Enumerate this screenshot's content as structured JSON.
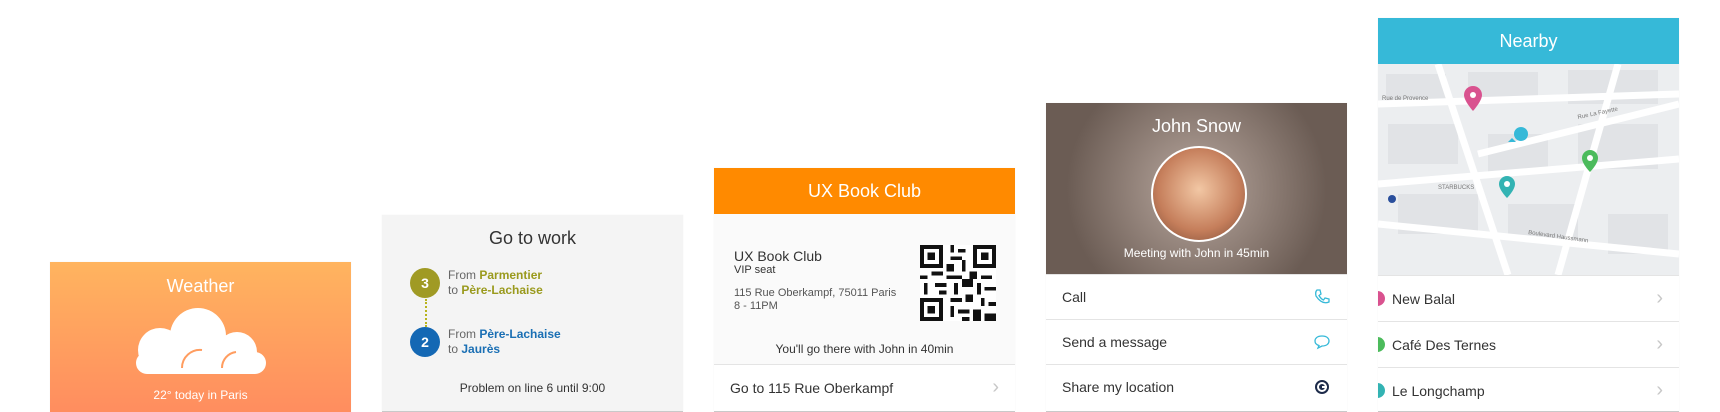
{
  "weather": {
    "title": "Weather",
    "summary": "22° today in Paris",
    "icon": "cloud-icon",
    "gradient": [
      "#ffb45f",
      "#ff8d5f"
    ]
  },
  "transit": {
    "title": "Go to work",
    "segments": [
      {
        "line": "3",
        "from_word": "From",
        "from": "Parmentier",
        "to_word": "to",
        "to": "Père-Lachaise",
        "color": "#a09a24"
      },
      {
        "line": "2",
        "from_word": "From",
        "from": "Père-Lachaise",
        "to_word": "to",
        "to": "Jaurès",
        "color": "#1468b4"
      }
    ],
    "problem": "Problem on line 6 until 9:00"
  },
  "ticket": {
    "header": "UX Book Club",
    "event_name": "UX Book Club",
    "seat": "VIP seat",
    "address": "115 Rue Oberkampf, 75011 Paris",
    "time": "8 - 11PM",
    "note": "You'll go there with John in 40min",
    "action": "Go to 115 Rue Oberkampf",
    "accent": "#ff8a00"
  },
  "contact": {
    "name": "John Snow",
    "subtitle": "Meeting with John in 45min",
    "actions": [
      {
        "label": "Call",
        "icon": "phone-icon"
      },
      {
        "label": "Send a message",
        "icon": "chat-bubble-icon"
      },
      {
        "label": "Share my location",
        "icon": "location-share-icon"
      }
    ]
  },
  "nearby": {
    "title": "Nearby",
    "places": [
      {
        "name": "New Balal",
        "color": "#d9528f"
      },
      {
        "name": "Café Des Ternes",
        "color": "#4cbb5c"
      },
      {
        "name": "Le Longchamp",
        "color": "#33b3b3"
      }
    ],
    "map_labels": {
      "street1": "Rue de Provence",
      "street2": "Boulevard Haussmann",
      "street3": "Rue La Fayette",
      "poi": "STARBUCKS"
    },
    "accent": "#36b9d8"
  }
}
